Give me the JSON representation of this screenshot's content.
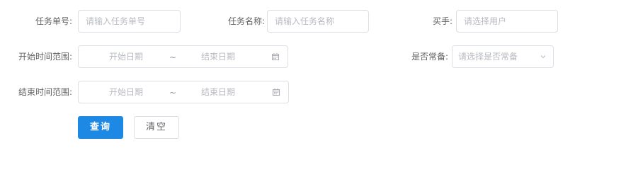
{
  "form": {
    "task_no": {
      "label": "任务单号:",
      "placeholder": "请输入任务单号"
    },
    "task_name": {
      "label": "任务名称:",
      "placeholder": "请输入任务名称"
    },
    "buyer": {
      "label": "买手:",
      "placeholder": "请选择用户"
    },
    "start_range": {
      "label": "开始时间范围:",
      "start_placeholder": "开始日期",
      "separator": "~",
      "end_placeholder": "结束日期",
      "icon": "calendar-icon"
    },
    "is_regular": {
      "label": "是否常备:",
      "placeholder": "请选择是否常备",
      "icon": "chevron-down-icon"
    },
    "end_range": {
      "label": "结束时间范围:",
      "start_placeholder": "开始日期",
      "separator": "~",
      "end_placeholder": "结束日期",
      "icon": "calendar-icon"
    }
  },
  "actions": {
    "query_label": "查询",
    "clear_label": "清空"
  },
  "colors": {
    "primary": "#1e88e5",
    "border": "#dcdfe6",
    "placeholder": "#b7bac1",
    "label": "#606266"
  }
}
